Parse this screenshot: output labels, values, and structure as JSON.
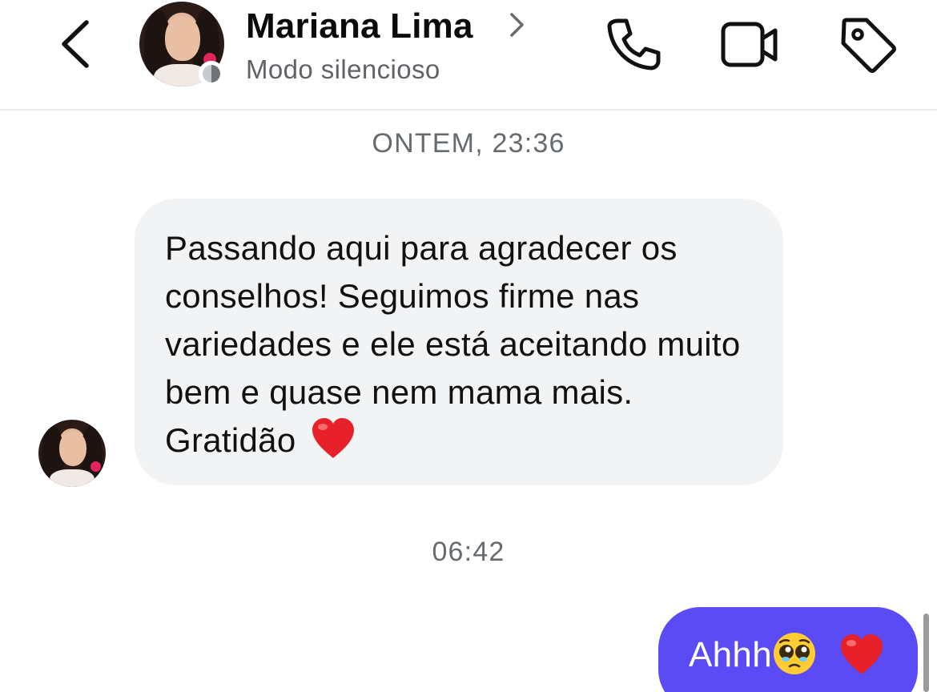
{
  "header": {
    "contact_name": "Mariana Lima",
    "contact_status": "Modo silencioso",
    "icons": {
      "back": "chevron-left-icon",
      "name_arrow": "chevron-right-icon",
      "call": "phone-icon",
      "video": "video-camera-icon",
      "tag": "tag-icon"
    }
  },
  "conversation": {
    "timestamps": [
      "ONTEM, 23:36",
      "06:42"
    ],
    "messages": [
      {
        "direction": "incoming",
        "text": "Passando aqui para agradecer os conselhos! Seguimos firme nas variedades e ele está aceitando muito bem e quase nem mama mais. Gratidão",
        "emoji": "heart"
      },
      {
        "direction": "outgoing",
        "text": "Ahhh",
        "emoji": [
          "pleading-face",
          "heart"
        ]
      }
    ]
  },
  "colors": {
    "outgoing_bubble": "#5b4bf5",
    "incoming_bubble": "#f1f3f5",
    "secondary_text": "#666b70",
    "heart": "#e8202a"
  }
}
